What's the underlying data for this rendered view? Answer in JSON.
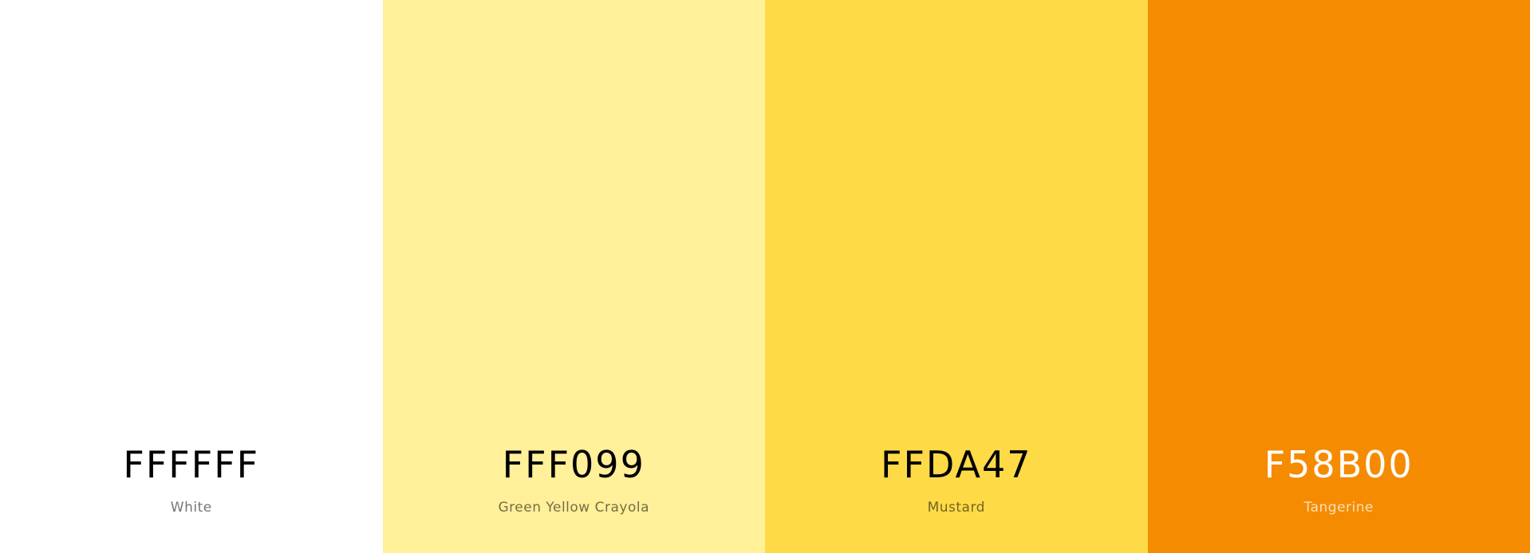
{
  "swatches": [
    {
      "hex": "FFFFFF",
      "name": "White",
      "color": "#FFFFFF"
    },
    {
      "hex": "FFF099",
      "name": "Green Yellow Crayola",
      "color": "#FFF099"
    },
    {
      "hex": "FFDA47",
      "name": "Mustard",
      "color": "#FFDA47"
    },
    {
      "hex": "F58B00",
      "name": "Tangerine",
      "color": "#F58B00"
    }
  ]
}
